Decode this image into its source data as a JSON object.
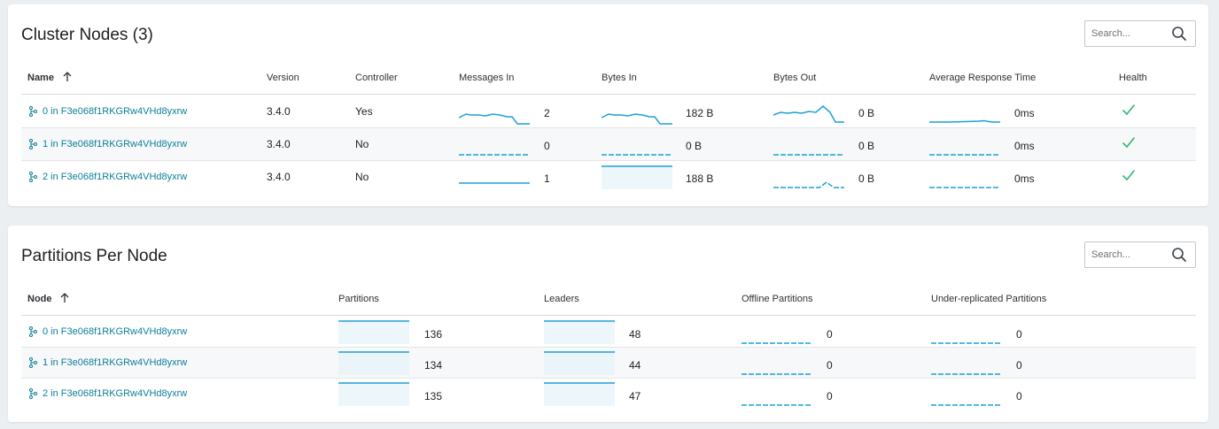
{
  "cluster_nodes": {
    "title": "Cluster Nodes (3)",
    "search_placeholder": "Search...",
    "columns": {
      "name": "Name",
      "version": "Version",
      "controller": "Controller",
      "messages_in": "Messages In",
      "bytes_in": "Bytes In",
      "bytes_out": "Bytes Out",
      "avg_response": "Average Response Time",
      "health": "Health"
    },
    "rows": [
      {
        "name": "0 in F3e068f1RKGRw4VHd8yxrw",
        "version": "3.4.0",
        "controller": "Yes",
        "messages_in": "2",
        "bytes_in": "182 B",
        "bytes_out": "0 B",
        "avg_response": "0ms",
        "health": "ok"
      },
      {
        "name": "1 in F3e068f1RKGRw4VHd8yxrw",
        "version": "3.4.0",
        "controller": "No",
        "messages_in": "0",
        "bytes_in": "0 B",
        "bytes_out": "0 B",
        "avg_response": "0ms",
        "health": "ok"
      },
      {
        "name": "2 in F3e068f1RKGRw4VHd8yxrw",
        "version": "3.4.0",
        "controller": "No",
        "messages_in": "1",
        "bytes_in": "188 B",
        "bytes_out": "0 B",
        "avg_response": "0ms",
        "health": "ok"
      }
    ]
  },
  "partitions_per_node": {
    "title": "Partitions Per Node",
    "search_placeholder": "Search...",
    "columns": {
      "node": "Node",
      "partitions": "Partitions",
      "leaders": "Leaders",
      "offline": "Offline Partitions",
      "under_replicated": "Under-replicated Partitions"
    },
    "rows": [
      {
        "name": "0 in F3e068f1RKGRw4VHd8yxrw",
        "partitions": "136",
        "leaders": "48",
        "offline": "0",
        "under_replicated": "0"
      },
      {
        "name": "1 in F3e068f1RKGRw4VHd8yxrw",
        "partitions": "134",
        "leaders": "44",
        "offline": "0",
        "under_replicated": "0"
      },
      {
        "name": "2 in F3e068f1RKGRw4VHd8yxrw",
        "partitions": "135",
        "leaders": "47",
        "offline": "0",
        "under_replicated": "0"
      }
    ]
  },
  "colors": {
    "link": "#0c7f98",
    "sparkline": "#1ba1d6",
    "sparkline_fill": "#e6f4fa",
    "health_ok": "#2eb872"
  },
  "icons": {
    "search": "search-icon",
    "sort": "arrow-up-icon",
    "node": "node-icon",
    "health": "checkmark-icon"
  }
}
